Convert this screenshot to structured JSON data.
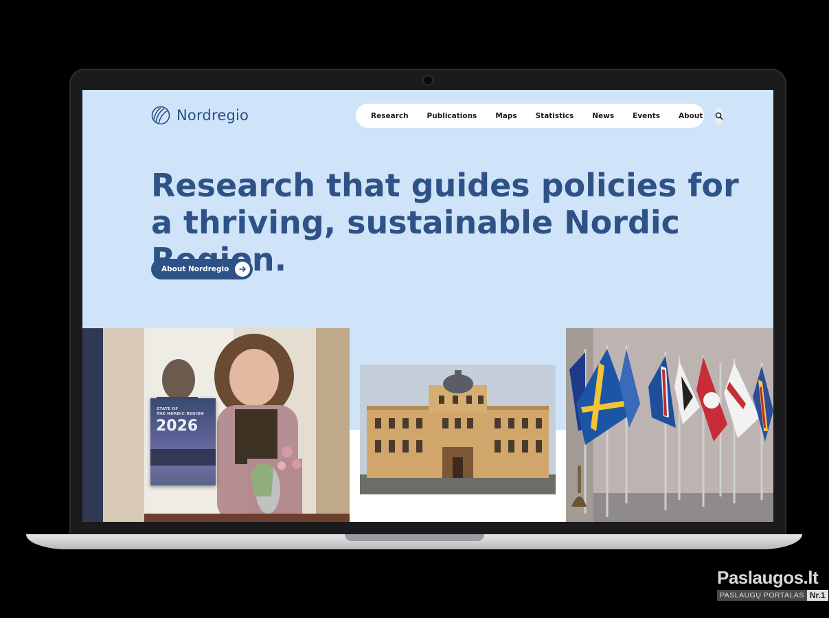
{
  "brand": {
    "name": "Nordregio"
  },
  "nav": {
    "items": [
      "Research",
      "Publications",
      "Maps",
      "Statistics",
      "News",
      "Events",
      "About"
    ]
  },
  "hero": {
    "title": "Research that guides policies for a thriving, sustainable Nordic Region.",
    "cta_label": "About Nordregio"
  },
  "report_cover": {
    "line1": "STATE OF",
    "line2": "THE NORDIC REGION",
    "year": "2026"
  },
  "watermark": {
    "title": "Paslaugos.lt",
    "sub_left": "PASLAUGŲ PORTALAS",
    "sub_right": "Nr.1"
  },
  "colors": {
    "primary": "#2e5286",
    "background": "#cfe4f8",
    "nav_bg": "#ffffff"
  },
  "icons": {
    "logo": "nordregio-logo-icon",
    "search": "search-icon",
    "cta": "arrow-right-icon"
  }
}
